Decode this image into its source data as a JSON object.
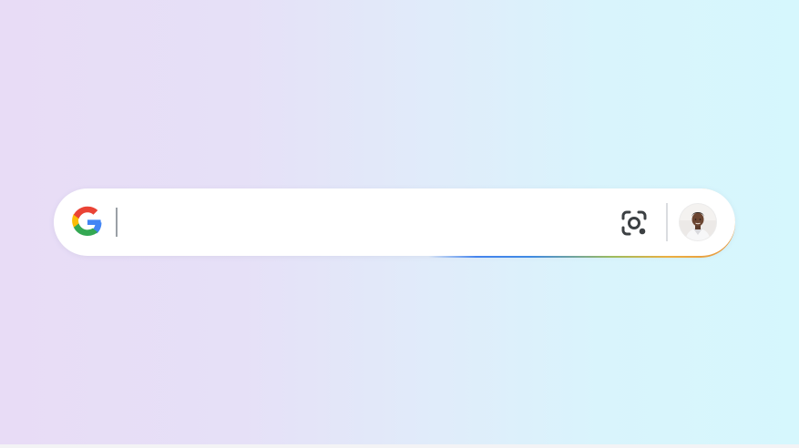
{
  "search": {
    "value": "",
    "placeholder": ""
  },
  "icons": {
    "logo": "google-g-icon",
    "lens": "camera-lens-icon",
    "avatar": "user-avatar"
  },
  "colors": {
    "google_blue": "#4285F4",
    "google_red": "#EA4335",
    "google_yellow": "#FBBC05",
    "google_green": "#34A853",
    "lens_icon": "#3c4043"
  }
}
